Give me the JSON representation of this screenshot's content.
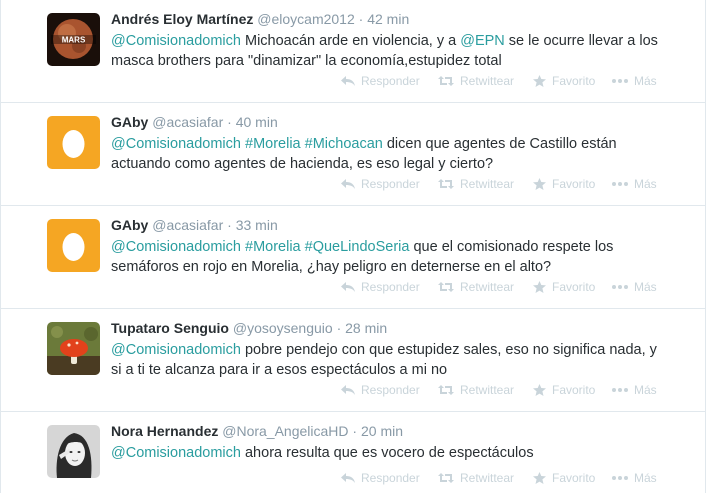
{
  "tweets": [
    {
      "fullname": "Andrés Eloy Martínez",
      "username": "@eloycam2012",
      "time": "42 min",
      "avatar": "mars-planet-avatar",
      "parts": [
        {
          "t": "mention",
          "v": "@Comisionadomich"
        },
        {
          "t": "text",
          "v": " Michoacán arde en violencia, y a "
        },
        {
          "t": "mention",
          "v": "@EPN"
        },
        {
          "t": "text",
          "v": " se le ocurre llevar a los masca brothers para \"dinamizar\" la economía,estupidez total"
        }
      ]
    },
    {
      "fullname": "GAby",
      "username": "@acasiafar",
      "time": "40 min",
      "avatar": "default-egg-avatar",
      "parts": [
        {
          "t": "mention",
          "v": "@Comisionadomich"
        },
        {
          "t": "text",
          "v": " "
        },
        {
          "t": "hashtag",
          "v": "#Morelia"
        },
        {
          "t": "text",
          "v": " "
        },
        {
          "t": "hashtag",
          "v": "#Michoacan"
        },
        {
          "t": "text",
          "v": " dicen que agentes de Castillo están actuando como agentes de hacienda, es eso legal y cierto?"
        }
      ]
    },
    {
      "fullname": "GAby",
      "username": "@acasiafar",
      "time": "33 min",
      "avatar": "default-egg-avatar",
      "parts": [
        {
          "t": "mention",
          "v": "@Comisionadomich"
        },
        {
          "t": "text",
          "v": " "
        },
        {
          "t": "hashtag",
          "v": "#Morelia"
        },
        {
          "t": "text",
          "v": " "
        },
        {
          "t": "hashtag",
          "v": "#QueLindoSeria"
        },
        {
          "t": "text",
          "v": " que el comisionado respete los semáforos en rojo en Morelia, ¿hay peligro en deternerse en el alto?"
        }
      ]
    },
    {
      "fullname": "Tupataro Senguio",
      "username": "@yosoysenguio",
      "time": "28 min",
      "avatar": "mushroom-avatar",
      "parts": [
        {
          "t": "mention",
          "v": "@Comisionadomich"
        },
        {
          "t": "text",
          "v": " pobre pendejo con que estupidez sales, eso no significa nada, y si a ti te alcanza para ir a esos espectáculos a mi no"
        }
      ]
    },
    {
      "fullname": "Nora Hernandez",
      "username": "@Nora_AngelicaHD",
      "time": "20 min",
      "avatar": "woman-portrait-avatar",
      "parts": [
        {
          "t": "mention",
          "v": "@Comisionadomich"
        },
        {
          "t": "text",
          "v": " ahora resulta que es vocero de espectáculos"
        }
      ]
    }
  ],
  "actions": {
    "reply": "Responder",
    "retweet": "Retwittear",
    "favorite": "Favorito",
    "more": "Más"
  },
  "separator": "·",
  "colors": {
    "link": "#2a9d9f",
    "muted": "#8899a6",
    "action": "#c9d4da",
    "egg_bg": "#f5a623"
  }
}
